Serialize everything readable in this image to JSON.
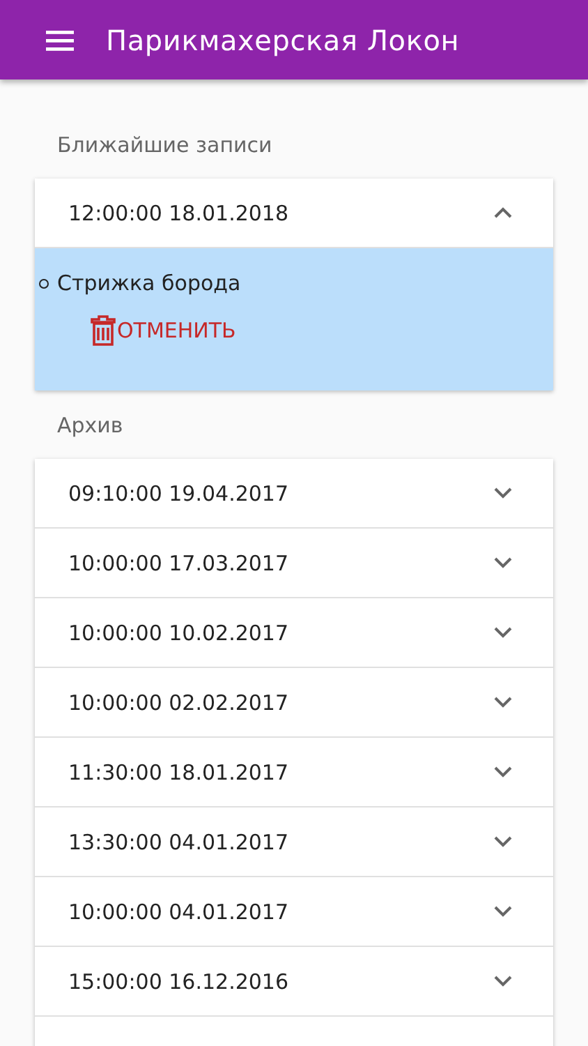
{
  "app_bar": {
    "title": "Парикмахерская Локон"
  },
  "upcoming": {
    "heading": "Ближайшие записи",
    "items": [
      {
        "datetime": "12:00:00 18.01.2018",
        "expanded": true,
        "services": [
          "Стрижка борода"
        ],
        "cancel_label": "ОТМЕНИТЬ"
      }
    ]
  },
  "archive": {
    "heading": "Архив",
    "items": [
      {
        "datetime": "09:10:00 19.04.2017",
        "expanded": false
      },
      {
        "datetime": "10:00:00 17.03.2017",
        "expanded": false
      },
      {
        "datetime": "10:00:00 10.02.2017",
        "expanded": false
      },
      {
        "datetime": "10:00:00 02.02.2017",
        "expanded": false
      },
      {
        "datetime": "11:30:00 18.01.2017",
        "expanded": false
      },
      {
        "datetime": "13:30:00 04.01.2017",
        "expanded": false
      },
      {
        "datetime": "10:00:00 04.01.2017",
        "expanded": false
      },
      {
        "datetime": "15:00:00 16.12.2016",
        "expanded": false
      }
    ]
  }
}
